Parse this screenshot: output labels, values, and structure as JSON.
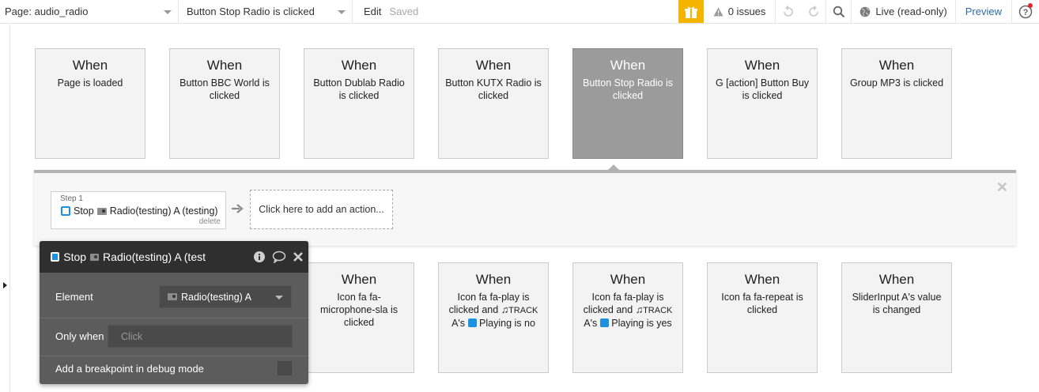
{
  "topbar": {
    "page_select": "Page: audio_radio",
    "event_select": "Button Stop Radio is clicked",
    "edit_label": "Edit",
    "saved_label": "Saved",
    "issues_label": "0 issues",
    "live_label": "Live (read-only)",
    "preview_label": "Preview",
    "gift_color": "#f5b400",
    "help_dot_color": "#e0292d"
  },
  "events_top": [
    {
      "when": "When",
      "text": "Page is loaded"
    },
    {
      "when": "When",
      "text": "Button BBC World is clicked"
    },
    {
      "when": "When",
      "text": "Button Dublab Radio is clicked"
    },
    {
      "when": "When",
      "text": "Button KUTX Radio is clicked"
    },
    {
      "when": "When",
      "text": "Button Stop Radio is clicked"
    },
    {
      "when": "When",
      "text": "G [action] Button Buy is clicked"
    },
    {
      "when": "When",
      "text": "Group MP3 is clicked"
    }
  ],
  "events_bottom": [
    {
      "when": "When",
      "text": "Icon fa fa-microphone-sla is clicked"
    },
    {
      "when": "When",
      "line1": "Icon fa fa-play is clicked and",
      "track": "TRACK",
      "line2_pre": "A's",
      "line2_post": "Playing is no"
    },
    {
      "when": "When",
      "line1": "Icon fa fa-play is clicked and",
      "track": "TRACK",
      "line2_pre": "A's",
      "line2_post": "Playing is yes"
    },
    {
      "when": "When",
      "text": "Icon fa fa-repeat is clicked"
    },
    {
      "when": "When",
      "text": "SliderInput A's value is changed"
    }
  ],
  "action_panel": {
    "step_label": "Step 1",
    "step_action": "Stop",
    "step_target": "Radio(testing) A (testing)",
    "delete_label": "delete",
    "add_action_label": "Click here to add an action..."
  },
  "property_editor": {
    "title_action": "Stop",
    "title_target": "Radio(testing) A (test",
    "element_label": "Element",
    "element_value": "Radio(testing) A",
    "only_when_label": "Only when",
    "only_when_placeholder": "Click",
    "breakpoint_label": "Add a breakpoint in debug mode"
  }
}
